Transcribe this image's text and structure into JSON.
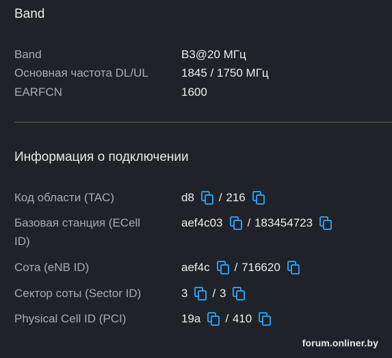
{
  "band_section": {
    "title": "Band",
    "rows": [
      {
        "label": "Band",
        "value": "B3@20 МГц"
      },
      {
        "label": "Основная частота DL/UL",
        "value": "1845 / 1750 МГц"
      },
      {
        "label": "EARFCN",
        "value": "1600"
      }
    ]
  },
  "connection_section": {
    "title": "Информация о подключении",
    "rows": [
      {
        "label": "Код области (TAC)",
        "hex": "d8",
        "sep": "/",
        "dec": "216"
      },
      {
        "label": "Базовая станция (ECell ID)",
        "hex": "aef4c03",
        "sep": "/",
        "dec": "183454723"
      },
      {
        "label": "Сота (eNB ID)",
        "hex": "aef4c",
        "sep": "/",
        "dec": "716620"
      },
      {
        "label": "Сектор соты (Sector ID)",
        "hex": "3",
        "sep": "/",
        "dec": "3"
      },
      {
        "label": "Physical Cell ID (PCI)",
        "hex": "19a",
        "sep": "/",
        "dec": "410"
      }
    ]
  },
  "icons": {
    "copy": "copy-icon",
    "accent": "#2d9bf0"
  },
  "watermark": "forum.onliner.by"
}
